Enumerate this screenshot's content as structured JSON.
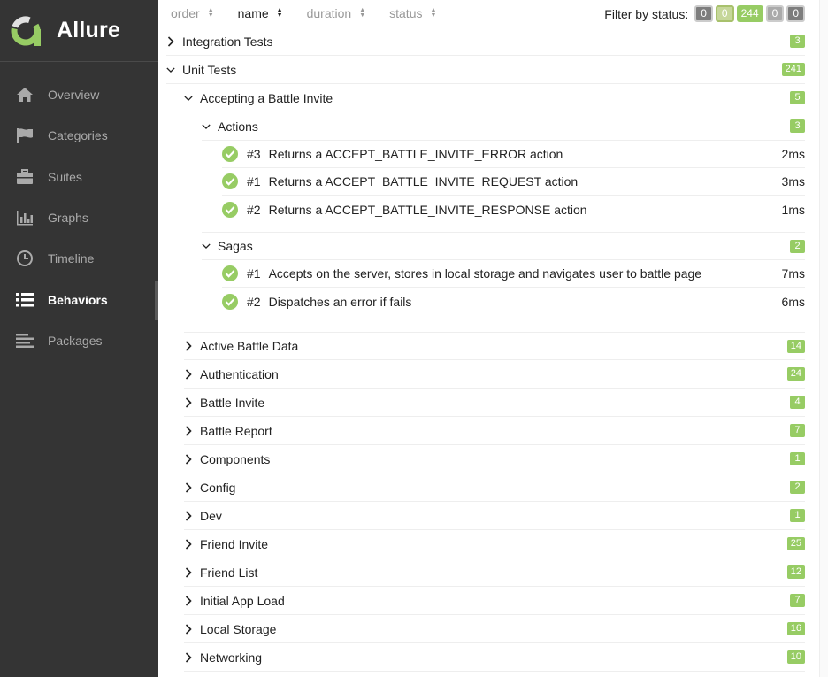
{
  "brand": {
    "name": "Allure",
    "accent": "#97cc64"
  },
  "nav": [
    {
      "label": "Overview",
      "icon": "home-icon"
    },
    {
      "label": "Categories",
      "icon": "flag-icon"
    },
    {
      "label": "Suites",
      "icon": "briefcase-icon"
    },
    {
      "label": "Graphs",
      "icon": "bar-chart-icon"
    },
    {
      "label": "Timeline",
      "icon": "clock-icon"
    },
    {
      "label": "Behaviors",
      "icon": "list-icon"
    },
    {
      "label": "Packages",
      "icon": "align-left-icon"
    }
  ],
  "sort": {
    "order": "order",
    "name": "name",
    "duration": "duration",
    "status": "status"
  },
  "filter": {
    "label": "Filter by status:",
    "failed": "0",
    "broken": "0",
    "passed": "244",
    "skipped": "0",
    "unknown": "0"
  },
  "tree": {
    "integration": {
      "label": "Integration Tests",
      "count": "3"
    },
    "unit": {
      "label": "Unit Tests",
      "count": "241"
    },
    "invite": {
      "label": "Accepting a Battle Invite",
      "count": "5"
    },
    "actions": {
      "label": "Actions",
      "count": "3"
    },
    "actionTests": [
      {
        "num": "#3",
        "name": "Returns a ACCEPT_BATTLE_INVITE_ERROR action",
        "duration": "2ms"
      },
      {
        "num": "#1",
        "name": "Returns a ACCEPT_BATTLE_INVITE_REQUEST action",
        "duration": "3ms"
      },
      {
        "num": "#2",
        "name": "Returns a ACCEPT_BATTLE_INVITE_RESPONSE action",
        "duration": "1ms"
      }
    ],
    "sagas": {
      "label": "Sagas",
      "count": "2"
    },
    "sagaTests": [
      {
        "num": "#1",
        "name": "Accepts on the server, stores in local storage and navigates user to battle page",
        "duration": "7ms"
      },
      {
        "num": "#2",
        "name": "Dispatches an error if fails",
        "duration": "6ms"
      }
    ],
    "groups": [
      {
        "label": "Active Battle Data",
        "count": "14"
      },
      {
        "label": "Authentication",
        "count": "24"
      },
      {
        "label": "Battle Invite",
        "count": "4"
      },
      {
        "label": "Battle Report",
        "count": "7"
      },
      {
        "label": "Components",
        "count": "1"
      },
      {
        "label": "Config",
        "count": "2"
      },
      {
        "label": "Dev",
        "count": "1"
      },
      {
        "label": "Friend Invite",
        "count": "25"
      },
      {
        "label": "Friend List",
        "count": "12"
      },
      {
        "label": "Initial App Load",
        "count": "7"
      },
      {
        "label": "Local Storage",
        "count": "16"
      },
      {
        "label": "Networking",
        "count": "10"
      }
    ]
  }
}
